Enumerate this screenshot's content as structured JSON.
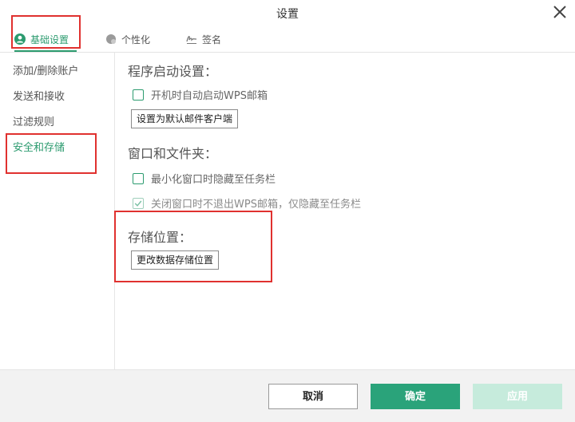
{
  "window": {
    "title": "设置"
  },
  "tabs": [
    {
      "label": "基础设置",
      "icon": "user-icon",
      "active": true
    },
    {
      "label": "个性化",
      "icon": "palette-icon",
      "active": false
    },
    {
      "label": "签名",
      "icon": "signature-icon",
      "active": false
    }
  ],
  "sidebar": {
    "items": [
      {
        "label": "添加/删除账户"
      },
      {
        "label": "发送和接收"
      },
      {
        "label": "过滤规则"
      },
      {
        "label": "安全和存储",
        "active": true
      }
    ]
  },
  "startup": {
    "title": "程序启动设置：",
    "autostart_label": "开机时自动启动WPS邮箱",
    "autostart_checked": false,
    "default_client_button": "设置为默认邮件客户端"
  },
  "window_folder": {
    "title": "窗口和文件夹：",
    "minimize_label": "最小化窗口时隐藏至任务栏",
    "minimize_checked": false,
    "close_label": "关闭窗口时不退出WPS邮箱，仅隐藏至任务栏",
    "close_checked": true
  },
  "storage": {
    "title": "存储位置：",
    "change_button": "更改数据存储位置"
  },
  "footer": {
    "cancel_label": "取消",
    "ok_label": "确定",
    "apply_label": "应用"
  },
  "colors": {
    "accent": "#2c9b6f",
    "annotation": "#e0312f"
  }
}
